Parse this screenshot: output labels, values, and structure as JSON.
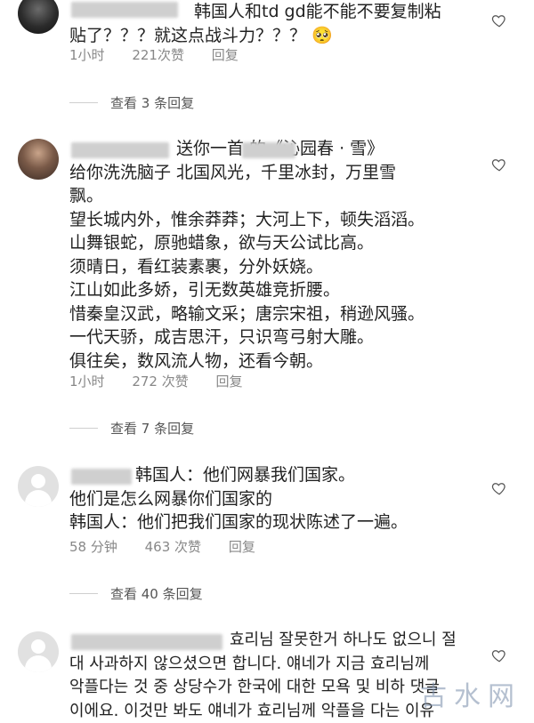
{
  "comments": [
    {
      "lines": [
        "韩国人和td gd能不能不要复制粘",
        "贴了？？？就这点战斗力？？？ 🥺"
      ],
      "time": "1小时",
      "likes": "221次赞",
      "reply": "回复",
      "more": "查看 3 条回复"
    },
    {
      "lines": [
        "送你一首        的《沁园春 · 雪》",
        "给你洗洗脑子  北国风光，千里冰封，万里雪",
        "飘。",
        "望长城内外，惟余莽莽；大河上下，顿失滔滔。",
        "山舞银蛇，原驰蜡象，欲与天公试比高。",
        "须晴日，看红装素裹，分外妖娆。",
        "江山如此多娇，引无数英雄竞折腰。",
        "惜秦皇汉武，略输文采；唐宗宋祖，稍逊风骚。",
        "一代天骄，成吉思汗，只识弯弓射大雕。",
        "俱往矣，数风流人物，还看今朝。"
      ],
      "time": "1小时",
      "likes": "272 次赞",
      "reply": "回复",
      "more": "查看 7 条回复"
    },
    {
      "lines": [
        "韩国人：他们网暴我们国家。",
        "他们是怎么网暴你们国家的",
        "韩国人：他们把我们国家的现状陈述了一遍。"
      ],
      "time": "58 分钟",
      "likes": "463 次赞",
      "reply": "回复",
      "more": "查看 40 条回复"
    },
    {
      "lines": [
        "효리님 잘못한거 하나도 없으니 절",
        "대 사과하지 않으셨으면 합니다. 얘네가 지금 효리님께",
        "악플다는 것 중 상당수가 한국에 대한 모욕 및 비하 댓글",
        "이에요. 이것만 봐도 얘네가 효리님께 악플을 다는 이유"
      ],
      "time": "",
      "likes": "",
      "reply": "",
      "more": ""
    }
  ],
  "watermark": "古水网"
}
